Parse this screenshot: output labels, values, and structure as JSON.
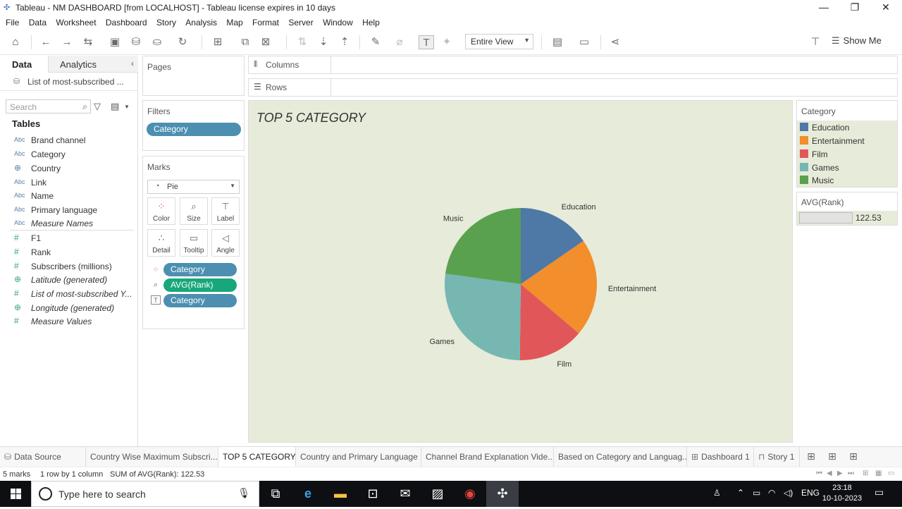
{
  "window": {
    "title": "Tableau - NM DASHBOARD [from LOCALHOST] - Tableau license expires in 10 days",
    "minimize": "—",
    "restore": "❐",
    "close": "✕"
  },
  "menu": [
    "File",
    "Data",
    "Worksheet",
    "Dashboard",
    "Story",
    "Analysis",
    "Map",
    "Format",
    "Server",
    "Window",
    "Help"
  ],
  "toolbar": {
    "fit_label": "Entire View",
    "show_me_label": "Show Me"
  },
  "data_pane": {
    "tab_data": "Data",
    "tab_analytics": "Analytics",
    "data_source": "List of most-subscribed ...",
    "search_placeholder": "Search",
    "tables_heading": "Tables",
    "dimensions": [
      {
        "type": "Abc",
        "name": "Brand channel"
      },
      {
        "type": "Abc",
        "name": "Category"
      },
      {
        "type": "geo",
        "name": "Country"
      },
      {
        "type": "Abc",
        "name": "Link"
      },
      {
        "type": "Abc",
        "name": "Name"
      },
      {
        "type": "Abc",
        "name": "Primary language"
      },
      {
        "type": "Abc",
        "name": "Measure Names"
      }
    ],
    "measures": [
      {
        "type": "#",
        "name": "F1"
      },
      {
        "type": "#",
        "name": "Rank"
      },
      {
        "type": "#",
        "name": "Subscribers (millions)"
      },
      {
        "type": "geo",
        "name": "Latitude (generated)"
      },
      {
        "type": "#",
        "name": "List of most-subscribed Y..."
      },
      {
        "type": "geo",
        "name": "Longitude (generated)"
      },
      {
        "type": "#",
        "name": "Measure Values"
      }
    ]
  },
  "pages_card": {
    "title": "Pages"
  },
  "filters_card": {
    "title": "Filters",
    "pill": "Category"
  },
  "marks_card": {
    "title": "Marks",
    "mark_type": "Pie",
    "buttons": [
      "Color",
      "Size",
      "Label",
      "Detail",
      "Tooltip",
      "Angle"
    ],
    "pills": [
      {
        "label": "Category",
        "kind": "color"
      },
      {
        "label": "AVG(Rank)",
        "kind": "size"
      },
      {
        "label": "Category",
        "kind": "label"
      }
    ]
  },
  "shelves": {
    "columns": "Columns",
    "rows": "Rows"
  },
  "viz": {
    "title": "TOP 5 CATEGORY"
  },
  "chart_data": {
    "type": "pie",
    "title": "TOP 5 CATEGORY",
    "labels": [
      "Education",
      "Entertainment",
      "Film",
      "Games",
      "Music"
    ],
    "values": [
      15.4,
      20.8,
      14.0,
      27.0,
      22.8
    ],
    "colors": [
      "#4e79a7",
      "#f28e2b",
      "#e15759",
      "#76b7b2",
      "#59a14f"
    ],
    "legend_position": "right"
  },
  "legend": {
    "title": "Category",
    "items": [
      {
        "label": "Education",
        "color": "#4e79a7"
      },
      {
        "label": "Entertainment",
        "color": "#f28e2b"
      },
      {
        "label": "Film",
        "color": "#e15759"
      },
      {
        "label": "Games",
        "color": "#76b7b2"
      },
      {
        "label": "Music",
        "color": "#59a14f"
      }
    ]
  },
  "size_legend": {
    "title": "AVG(Rank)",
    "value": "122.53"
  },
  "sheet_tabs": [
    {
      "label": "Data Source",
      "active": false
    },
    {
      "label": "Country Wise Maximum Subscri...",
      "active": false
    },
    {
      "label": "TOP 5 CATEGORY",
      "active": true
    },
    {
      "label": "Country and Primary Language",
      "active": false
    },
    {
      "label": "Channel Brand Explanation Vide...",
      "active": false
    },
    {
      "label": "Based on Category and Languag...",
      "active": false
    },
    {
      "label": "Dashboard 1",
      "active": false
    },
    {
      "label": "Story 1",
      "active": false
    }
  ],
  "status": {
    "marks": "5 marks",
    "dims": "1 row by 1 column",
    "sum": "SUM of AVG(Rank): 122.53"
  },
  "taskbar": {
    "search_placeholder": "Type here to search",
    "lang": "ENG",
    "time": "23:18",
    "date": "10-10-2023"
  }
}
